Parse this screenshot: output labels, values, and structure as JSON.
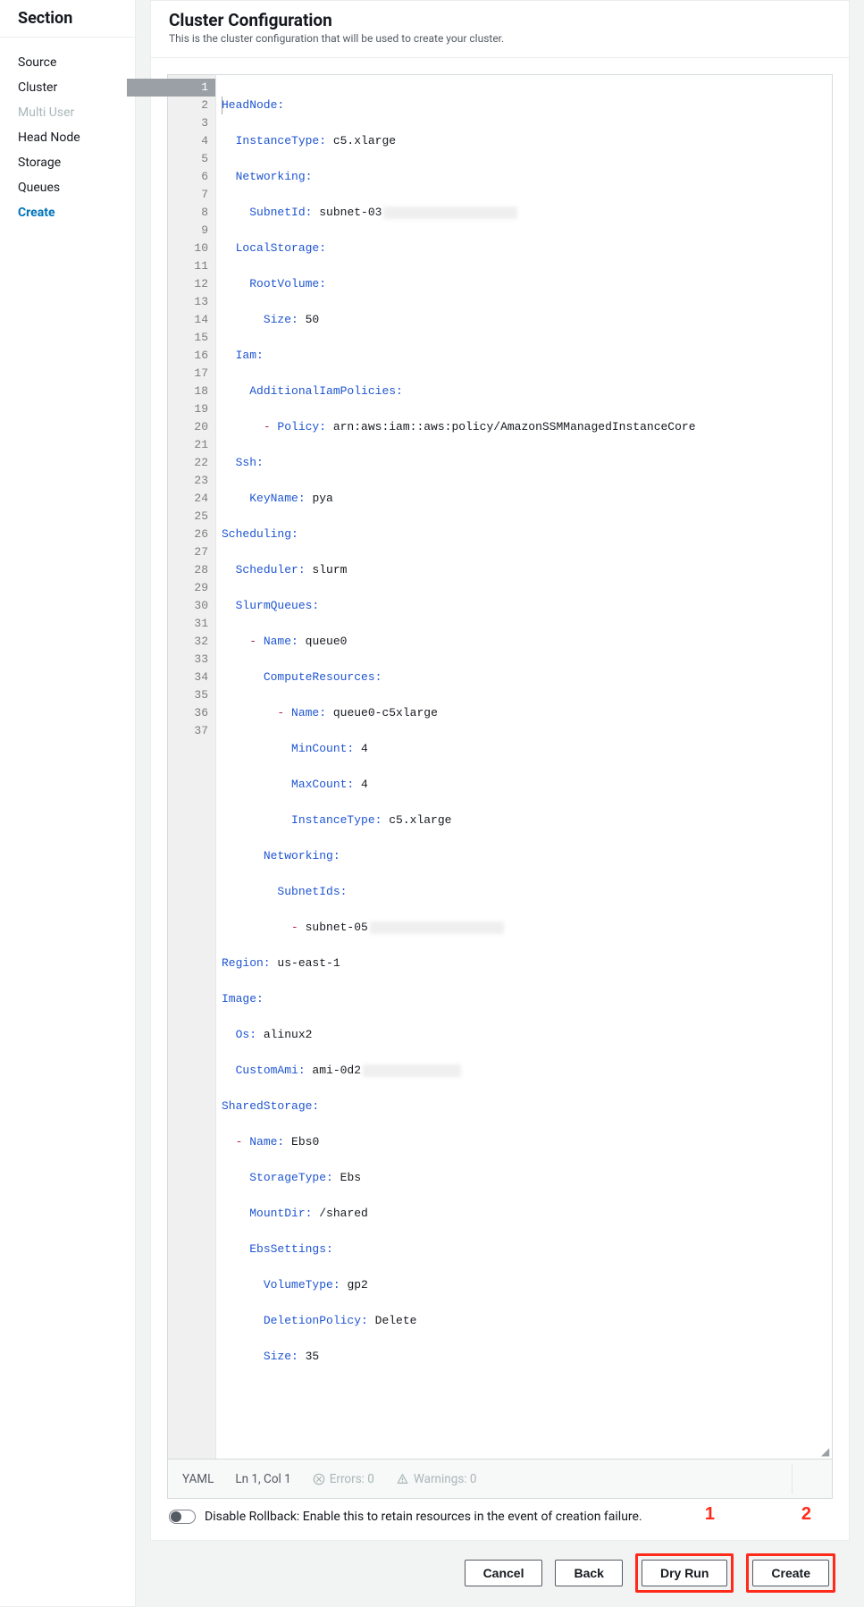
{
  "sidebar": {
    "title": "Section",
    "items": [
      {
        "label": "Source",
        "state": "normal"
      },
      {
        "label": "Cluster",
        "state": "normal"
      },
      {
        "label": "Multi User",
        "state": "disabled"
      },
      {
        "label": "Head Node",
        "state": "normal"
      },
      {
        "label": "Storage",
        "state": "normal"
      },
      {
        "label": "Queues",
        "state": "normal"
      },
      {
        "label": "Create",
        "state": "active"
      }
    ]
  },
  "header": {
    "title": "Cluster Configuration",
    "subtitle": "This is the cluster configuration that will be used to create your cluster."
  },
  "editor": {
    "language": "YAML",
    "cursor": "Ln 1, Col 1",
    "errors_label": "Errors: 0",
    "warnings_label": "Warnings: 0",
    "total_lines": 37,
    "yaml_visible": {
      "HeadNode": {
        "InstanceType": "c5.xlarge",
        "Networking": {
          "SubnetId": "subnet-03[redacted]"
        },
        "LocalStorage": {
          "RootVolume": {
            "Size": 50
          }
        },
        "Iam": {
          "AdditionalIamPolicies": [
            {
              "Policy": "arn:aws:iam::aws:policy/AmazonSSMManagedInstanceCore"
            }
          ]
        },
        "Ssh": {
          "KeyName": "pya"
        }
      },
      "Scheduling": {
        "Scheduler": "slurm",
        "SlurmQueues": [
          {
            "Name": "queue0",
            "ComputeResources": [
              {
                "Name": "queue0-c5xlarge",
                "MinCount": 4,
                "MaxCount": 4,
                "InstanceType": "c5.xlarge"
              }
            ],
            "Networking": {
              "SubnetIds": [
                "subnet-05[redacted]"
              ]
            }
          }
        ]
      },
      "Region": "us-east-1",
      "Image": {
        "Os": "alinux2",
        "CustomAmi": "ami-0d2[redacted]"
      },
      "SharedStorage": [
        {
          "Name": "Ebs0",
          "StorageType": "Ebs",
          "MountDir": "/shared",
          "EbsSettings": {
            "VolumeType": "gp2",
            "DeletionPolicy": "Delete",
            "Size": 35
          }
        }
      ]
    }
  },
  "rollback": {
    "label": "Disable Rollback: Enable this to retain resources in the event of creation failure."
  },
  "annotations": {
    "box1": "1",
    "box2": "2"
  },
  "buttons": {
    "cancel": "Cancel",
    "back": "Back",
    "dryrun": "Dry Run",
    "create": "Create"
  }
}
